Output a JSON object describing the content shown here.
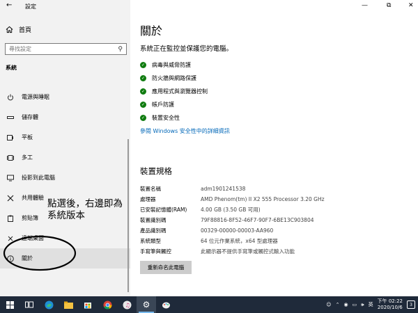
{
  "window": {
    "title": "設定",
    "minimize": "—",
    "maximize": "⧉",
    "close": "✕"
  },
  "sidebar": {
    "home_label": "首頁",
    "search_placeholder": "尋找設定",
    "section_label": "系統",
    "items": [
      {
        "label": "電源與睡眠",
        "icon": "power-icon"
      },
      {
        "label": "儲存體",
        "icon": "storage-icon"
      },
      {
        "label": "平板",
        "icon": "tablet-icon"
      },
      {
        "label": "多工",
        "icon": "multitask-icon"
      },
      {
        "label": "投影到此電腦",
        "icon": "project-icon"
      },
      {
        "label": "共用體驗",
        "icon": "shared-experience-icon"
      },
      {
        "label": "剪貼簿",
        "icon": "clipboard-icon"
      },
      {
        "label": "遠端桌面",
        "icon": "remote-desktop-icon"
      },
      {
        "label": "關於",
        "icon": "info-icon",
        "active": true
      }
    ]
  },
  "annotation": {
    "line1": "點選後，右邊即為",
    "line2": "系統版本"
  },
  "main": {
    "title": "關於",
    "protect_heading": "系統正在監控並保護您的電腦。",
    "protections": [
      "病毒與威脅防護",
      "防火牆與網路保護",
      "應用程式與瀏覽器控制",
      "帳戶防護",
      "裝置安全性"
    ],
    "security_link": "參閱 Windows 安全性中的詳細資訊",
    "specs_heading": "裝置規格",
    "specs": [
      {
        "key": "裝置名稱",
        "value": "adm1901241538"
      },
      {
        "key": "處理器",
        "value": "AMD Phenom(tm) II X2 555 Processor   3.20 GHz"
      },
      {
        "key": "已安裝記憶體(RAM)",
        "value": "4.00 GB (3.50 GB 可用)"
      },
      {
        "key": "裝置識別碼",
        "value": "79F88816-8F52-46F7-90F7-6BE13C903804"
      },
      {
        "key": "產品識別碼",
        "value": "00329-00000-00003-AA960"
      },
      {
        "key": "系統類型",
        "value": "64 位元作業系統，x64 型處理器"
      },
      {
        "key": "手寫筆與觸控",
        "value": "此顯示器不提供手寫筆或觸控式輸入功能"
      }
    ],
    "rename_button": "重新命名此電腦"
  },
  "taskbar": {
    "time": "下午 02:22",
    "date": "2020/10/6",
    "notification_count": "3",
    "colors": {
      "background": "#1f2a3a",
      "accent": "#76b9ed"
    }
  }
}
